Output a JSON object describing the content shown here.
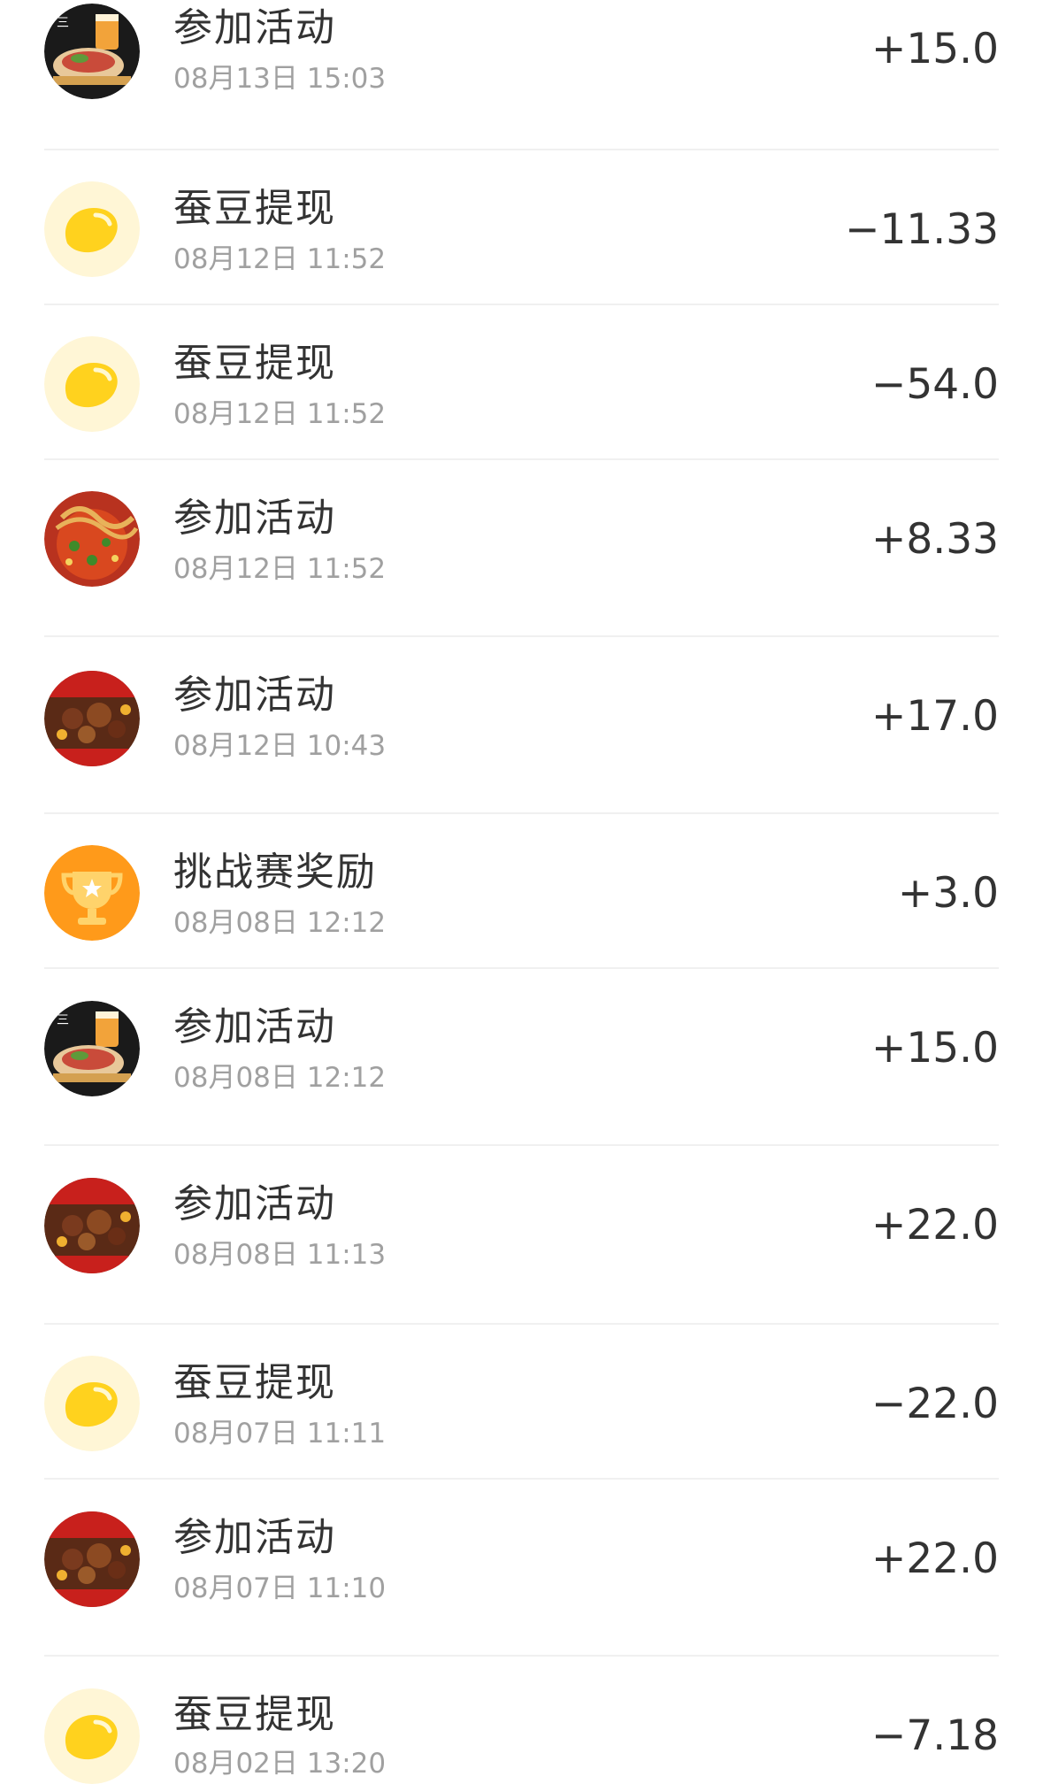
{
  "records": [
    {
      "title": "参加活动",
      "time": "08月13日 15:03",
      "amount": "+15.0",
      "icon": "wrap-food-icon"
    },
    {
      "title": "蚕豆提现",
      "time": "08月12日 11:52",
      "amount": "−11.33",
      "icon": "bean-icon"
    },
    {
      "title": "蚕豆提现",
      "time": "08月12日 11:52",
      "amount": "−54.0",
      "icon": "bean-icon"
    },
    {
      "title": "参加活动",
      "time": "08月12日 11:52",
      "amount": "+8.33",
      "icon": "noodles-food-icon"
    },
    {
      "title": "参加活动",
      "time": "08月12日 10:43",
      "amount": "+17.0",
      "icon": "duck-food-icon"
    },
    {
      "title": "挑战赛奖励",
      "time": "08月08日 12:12",
      "amount": "+3.0",
      "icon": "trophy-icon"
    },
    {
      "title": "参加活动",
      "time": "08月08日 12:12",
      "amount": "+15.0",
      "icon": "wrap-food-icon"
    },
    {
      "title": "参加活动",
      "time": "08月08日 11:13",
      "amount": "+22.0",
      "icon": "duck-food-icon"
    },
    {
      "title": "蚕豆提现",
      "time": "08月07日 11:11",
      "amount": "−22.0",
      "icon": "bean-icon"
    },
    {
      "title": "参加活动",
      "time": "08月07日 11:10",
      "amount": "+22.0",
      "icon": "duck-food-icon"
    },
    {
      "title": "蚕豆提现",
      "time": "08月02日 13:20",
      "amount": "−7.18",
      "icon": "bean-icon"
    }
  ],
  "colors": {
    "text": "#333333",
    "subtext": "#a0a0a0",
    "bean_yellow": "#ffd21e",
    "bean_bg": "#fff6d6",
    "trophy_orange": "#ff9a1a"
  }
}
